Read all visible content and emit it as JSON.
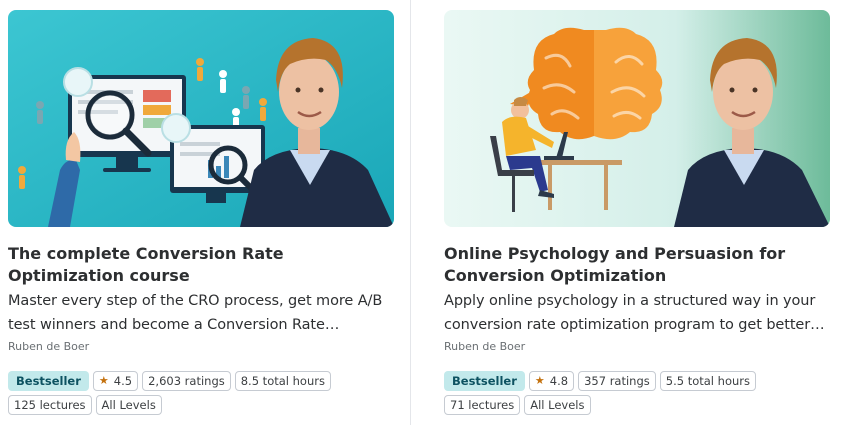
{
  "courses": [
    {
      "image_icon": "cro-analytics-illustration",
      "title": "The complete Conversion Rate Optimization course",
      "description": "Master every step of the CRO process, get more A/B test winners and become a Conversion Rate…",
      "instructor": "Ruben de Boer",
      "badge": "Bestseller",
      "rating": "4.5",
      "ratings_count": "2,603 ratings",
      "total_hours": "8.5 total hours",
      "lectures": "125 lectures",
      "level": "All Levels"
    },
    {
      "image_icon": "brain-psychology-illustration",
      "title": "Online Psychology and Persuasion for Conversion Optimization",
      "description": "Apply online psychology in a structured way in your conversion rate optimization program to get better…",
      "instructor": "Ruben de Boer",
      "badge": "Bestseller",
      "rating": "4.8",
      "ratings_count": "357 ratings",
      "total_hours": "5.5 total hours",
      "lectures": "71 lectures",
      "level": "All Levels"
    }
  ],
  "colors": {
    "badge_bg": "#c2e9eb",
    "badge_text": "#0d5261",
    "star": "#c4710d",
    "thumb1_bg": "#29b8c7",
    "thumb2_bg": "#dff3f0"
  }
}
